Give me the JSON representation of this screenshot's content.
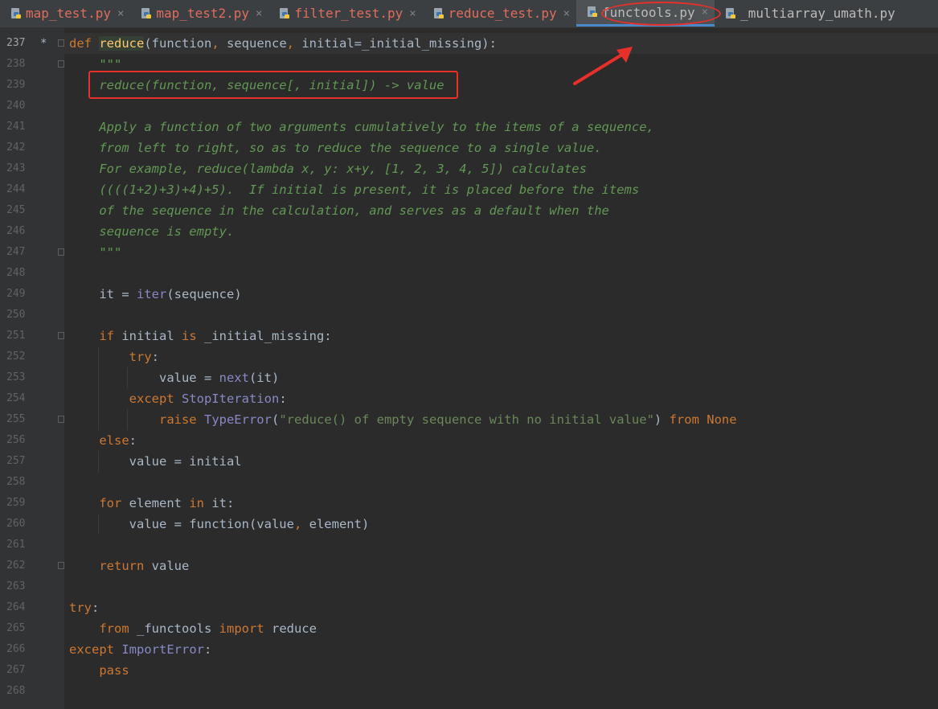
{
  "tabs": [
    {
      "label": "map_test.py",
      "state": "modified",
      "close": "×"
    },
    {
      "label": "map_test2.py",
      "state": "modified",
      "close": "×"
    },
    {
      "label": "filter_test.py",
      "state": "modified",
      "close": "×"
    },
    {
      "label": "reduce_test.py",
      "state": "modified",
      "close": "×"
    },
    {
      "label": "functools.py",
      "state": "active",
      "close": "×"
    },
    {
      "label": "_multiarray_umath.py",
      "state": "plain",
      "close": ""
    }
  ],
  "editor": {
    "first_line": 237,
    "current_line": 237,
    "modified_marker": "*",
    "lines": [
      {
        "n": "237",
        "code": [
          [
            "kw",
            "def "
          ],
          [
            "fn",
            "reduce"
          ],
          [
            "p",
            "(function"
          ],
          [
            "kw",
            ", "
          ],
          [
            "p",
            "sequence"
          ],
          [
            "kw",
            ", "
          ],
          [
            "p",
            "initial=_initial_missing):"
          ]
        ]
      },
      {
        "n": "238",
        "code": [
          [
            "p",
            "    "
          ],
          [
            "doc",
            "\"\"\""
          ]
        ]
      },
      {
        "n": "239",
        "code": [
          [
            "p",
            "    "
          ],
          [
            "doc",
            "reduce(function, sequence[, initial]) -> value"
          ]
        ]
      },
      {
        "n": "240",
        "code": []
      },
      {
        "n": "241",
        "code": [
          [
            "p",
            "    "
          ],
          [
            "doc",
            "Apply a function of two arguments cumulatively to the items of a sequence,"
          ]
        ]
      },
      {
        "n": "242",
        "code": [
          [
            "p",
            "    "
          ],
          [
            "doc",
            "from left to right, so as to reduce the sequence to a single value."
          ]
        ]
      },
      {
        "n": "243",
        "code": [
          [
            "p",
            "    "
          ],
          [
            "doc",
            "For example, reduce(lambda x, y: x+y, [1, 2, 3, 4, 5]) calculates"
          ]
        ]
      },
      {
        "n": "244",
        "code": [
          [
            "p",
            "    "
          ],
          [
            "doc",
            "((((1+2)+3)+4)+5).  If initial is present, it is placed before the items"
          ]
        ]
      },
      {
        "n": "245",
        "code": [
          [
            "p",
            "    "
          ],
          [
            "doc",
            "of the sequence in the calculation, and serves as a default when the"
          ]
        ]
      },
      {
        "n": "246",
        "code": [
          [
            "p",
            "    "
          ],
          [
            "doc",
            "sequence is empty."
          ]
        ]
      },
      {
        "n": "247",
        "code": [
          [
            "p",
            "    "
          ],
          [
            "doc",
            "\"\"\""
          ]
        ]
      },
      {
        "n": "248",
        "code": []
      },
      {
        "n": "249",
        "code": [
          [
            "p",
            "    it = "
          ],
          [
            "bi",
            "iter"
          ],
          [
            "p",
            "(sequence)"
          ]
        ]
      },
      {
        "n": "250",
        "code": []
      },
      {
        "n": "251",
        "code": [
          [
            "p",
            "    "
          ],
          [
            "kw",
            "if "
          ],
          [
            "p",
            "initial "
          ],
          [
            "kw",
            "is "
          ],
          [
            "p",
            "_initial_missing:"
          ]
        ]
      },
      {
        "n": "252",
        "code": [
          [
            "p",
            "        "
          ],
          [
            "kw",
            "try"
          ],
          [
            "p",
            ":"
          ]
        ]
      },
      {
        "n": "253",
        "code": [
          [
            "p",
            "            value = "
          ],
          [
            "bi",
            "next"
          ],
          [
            "p",
            "(it)"
          ]
        ]
      },
      {
        "n": "254",
        "code": [
          [
            "p",
            "        "
          ],
          [
            "kw",
            "except "
          ],
          [
            "bi",
            "StopIteration"
          ],
          [
            "p",
            ":"
          ]
        ]
      },
      {
        "n": "255",
        "code": [
          [
            "p",
            "            "
          ],
          [
            "kw",
            "raise "
          ],
          [
            "bi",
            "TypeError"
          ],
          [
            "p",
            "("
          ],
          [
            "str",
            "\"reduce() of empty sequence with no initial value\""
          ],
          [
            "p",
            ") "
          ],
          [
            "kw",
            "from None"
          ]
        ]
      },
      {
        "n": "256",
        "code": [
          [
            "p",
            "    "
          ],
          [
            "kw",
            "else"
          ],
          [
            "p",
            ":"
          ]
        ]
      },
      {
        "n": "257",
        "code": [
          [
            "p",
            "        value = initial"
          ]
        ]
      },
      {
        "n": "258",
        "code": []
      },
      {
        "n": "259",
        "code": [
          [
            "p",
            "    "
          ],
          [
            "kw",
            "for "
          ],
          [
            "p",
            "element "
          ],
          [
            "kw",
            "in "
          ],
          [
            "p",
            "it:"
          ]
        ]
      },
      {
        "n": "260",
        "code": [
          [
            "p",
            "        value = function(value"
          ],
          [
            "kw",
            ", "
          ],
          [
            "p",
            "element)"
          ]
        ]
      },
      {
        "n": "261",
        "code": []
      },
      {
        "n": "262",
        "code": [
          [
            "p",
            "    "
          ],
          [
            "kw",
            "return "
          ],
          [
            "p",
            "value"
          ]
        ]
      },
      {
        "n": "263",
        "code": []
      },
      {
        "n": "264",
        "code": [
          [
            "kw",
            "try"
          ],
          [
            "p",
            ":"
          ]
        ]
      },
      {
        "n": "265",
        "code": [
          [
            "p",
            "    "
          ],
          [
            "kw",
            "from "
          ],
          [
            "p",
            "_functools "
          ],
          [
            "kw",
            "import "
          ],
          [
            "p",
            "reduce"
          ]
        ]
      },
      {
        "n": "266",
        "code": [
          [
            "kw",
            "except "
          ],
          [
            "bi",
            "ImportError"
          ],
          [
            "p",
            ":"
          ]
        ]
      },
      {
        "n": "267",
        "code": [
          [
            "p",
            "    "
          ],
          [
            "kw",
            "pass"
          ]
        ]
      },
      {
        "n": "268",
        "code": []
      }
    ],
    "fold_lines": [
      "237",
      "238",
      "247",
      "251",
      "255",
      "262"
    ]
  },
  "colors": {
    "keyword": "#cc7832",
    "function_def": "#ffc66d",
    "docstring": "#629755",
    "builtin": "#8888c6",
    "string": "#6a8759",
    "plain": "#a9b7c6",
    "annotation": "#e8302a",
    "tab_active_underline": "#4a88c7"
  },
  "icons": {
    "tab_file_icon": "python-file-icon",
    "annotation_arrow": "red-arrow-icon"
  }
}
